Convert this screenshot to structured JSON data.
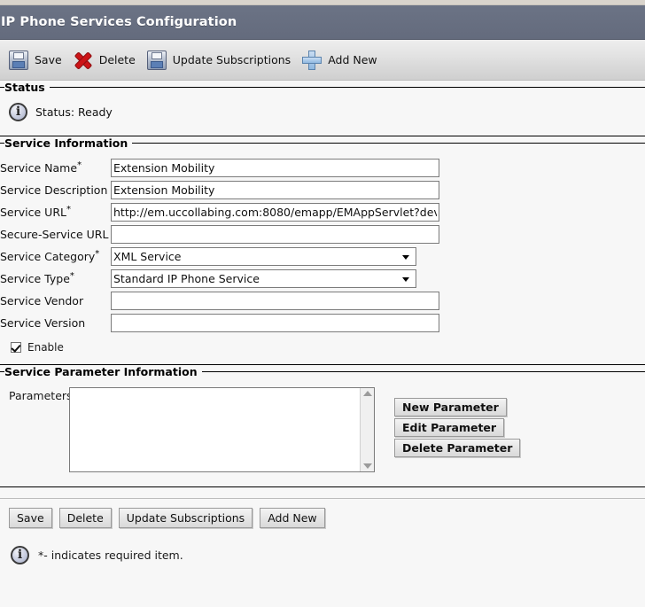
{
  "window": {
    "title": "IP Phone Services Configuration"
  },
  "toolbar": {
    "items": [
      {
        "label": "Save",
        "icon": "save-icon"
      },
      {
        "label": "Delete",
        "icon": "delete-x-icon"
      },
      {
        "label": "Update Subscriptions",
        "icon": "save-icon"
      },
      {
        "label": "Add New",
        "icon": "plus-icon"
      }
    ]
  },
  "status_section": {
    "legend": "Status",
    "icon": "info-icon",
    "text": "Status: Ready"
  },
  "service_information": {
    "legend": "Service Information",
    "fields": [
      {
        "label": "Service Name",
        "required": true,
        "type": "text",
        "value": "Extension Mobility"
      },
      {
        "label": "Service Description",
        "required": false,
        "type": "text",
        "value": "Extension Mobility"
      },
      {
        "label": "Service URL",
        "required": true,
        "type": "text",
        "value": "http://em.uccollabing.com:8080/emapp/EMAppServlet?dev"
      },
      {
        "label": "Secure-Service URL",
        "required": false,
        "type": "text",
        "value": ""
      },
      {
        "label": "Service Category",
        "required": true,
        "type": "select",
        "value": "XML Service"
      },
      {
        "label": "Service Type",
        "required": true,
        "type": "select",
        "value": "Standard IP Phone Service"
      },
      {
        "label": "Service Vendor",
        "required": false,
        "type": "text",
        "value": ""
      },
      {
        "label": "Service Version",
        "required": false,
        "type": "text",
        "value": ""
      }
    ],
    "enable_checkbox": {
      "label": "Enable",
      "checked": true
    }
  },
  "service_parameter_information": {
    "legend": "Service Parameter Information",
    "parameters_label": "Parameters",
    "parameters_items": [],
    "buttons": [
      {
        "label": "New Parameter"
      },
      {
        "label": "Edit Parameter"
      },
      {
        "label": "Delete Parameter"
      }
    ],
    "scrollbar": {
      "up_icon": "scroll-up-arrow-icon",
      "down_icon": "scroll-down-arrow-icon"
    }
  },
  "bottom_buttons": [
    {
      "label": "Save"
    },
    {
      "label": "Delete"
    },
    {
      "label": "Update Subscriptions"
    },
    {
      "label": "Add New"
    }
  ],
  "footer": {
    "icon": "info-icon",
    "text": "*- indicates required item."
  },
  "colors": {
    "title_bar": "#6b7385",
    "top_strip": "#d9d4cc",
    "page_background": "#f7f7f7",
    "delete_x": "#cc1417",
    "add_plus": "#8fb8e0"
  }
}
